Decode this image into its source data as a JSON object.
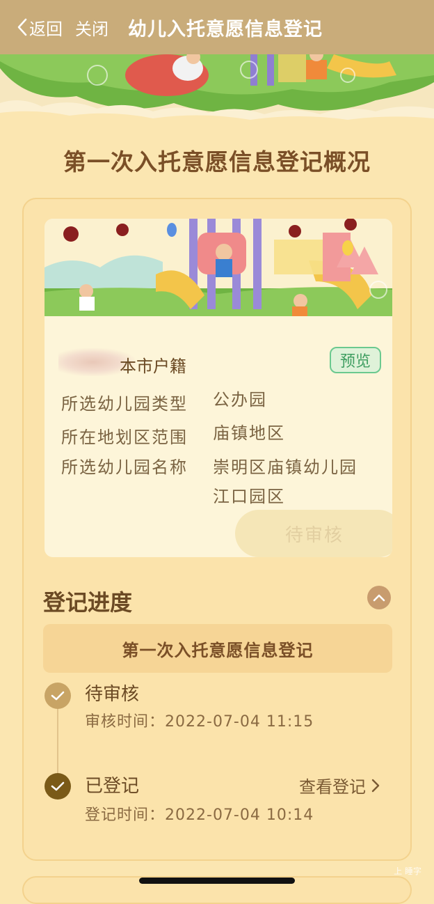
{
  "nav": {
    "back_label": "返回",
    "close_label": "关闭",
    "title": "幼儿入托意愿信息登记"
  },
  "page": {
    "heading": "第一次入托意愿信息登记概况"
  },
  "summary_card": {
    "residency": "本市户籍",
    "preview_label": "预览",
    "rows": [
      {
        "label": "所选幼儿园类型",
        "value": "公办园"
      },
      {
        "label": "所在地划区范围",
        "value": "庙镇地区"
      },
      {
        "label": "所选幼儿园名称",
        "value": "崇明区庙镇幼儿园江口园区"
      }
    ],
    "status": "待审核"
  },
  "progress": {
    "section_title": "登记进度",
    "registration_name": "第一次入托意愿信息登记",
    "steps": [
      {
        "title": "待审核",
        "time_label": "审核时间：",
        "time": "2022-07-04 11:15"
      },
      {
        "title": "已登记",
        "time_label": "登记时间：",
        "time": "2022-07-04 10:14",
        "link": "查看登记"
      }
    ]
  },
  "watermark": "上 睡字",
  "icons": [
    "chevron-left-icon",
    "chevron-up-icon",
    "check-icon",
    "chevron-right-icon"
  ],
  "colors": {
    "nav_bg": "#c9ac7a",
    "page_bg": "#fbe6b1",
    "accent_brown": "#6b4a24",
    "preview_green": "#3f9e61",
    "step_active": "#7a5a18",
    "step_done": "#c8a465"
  }
}
